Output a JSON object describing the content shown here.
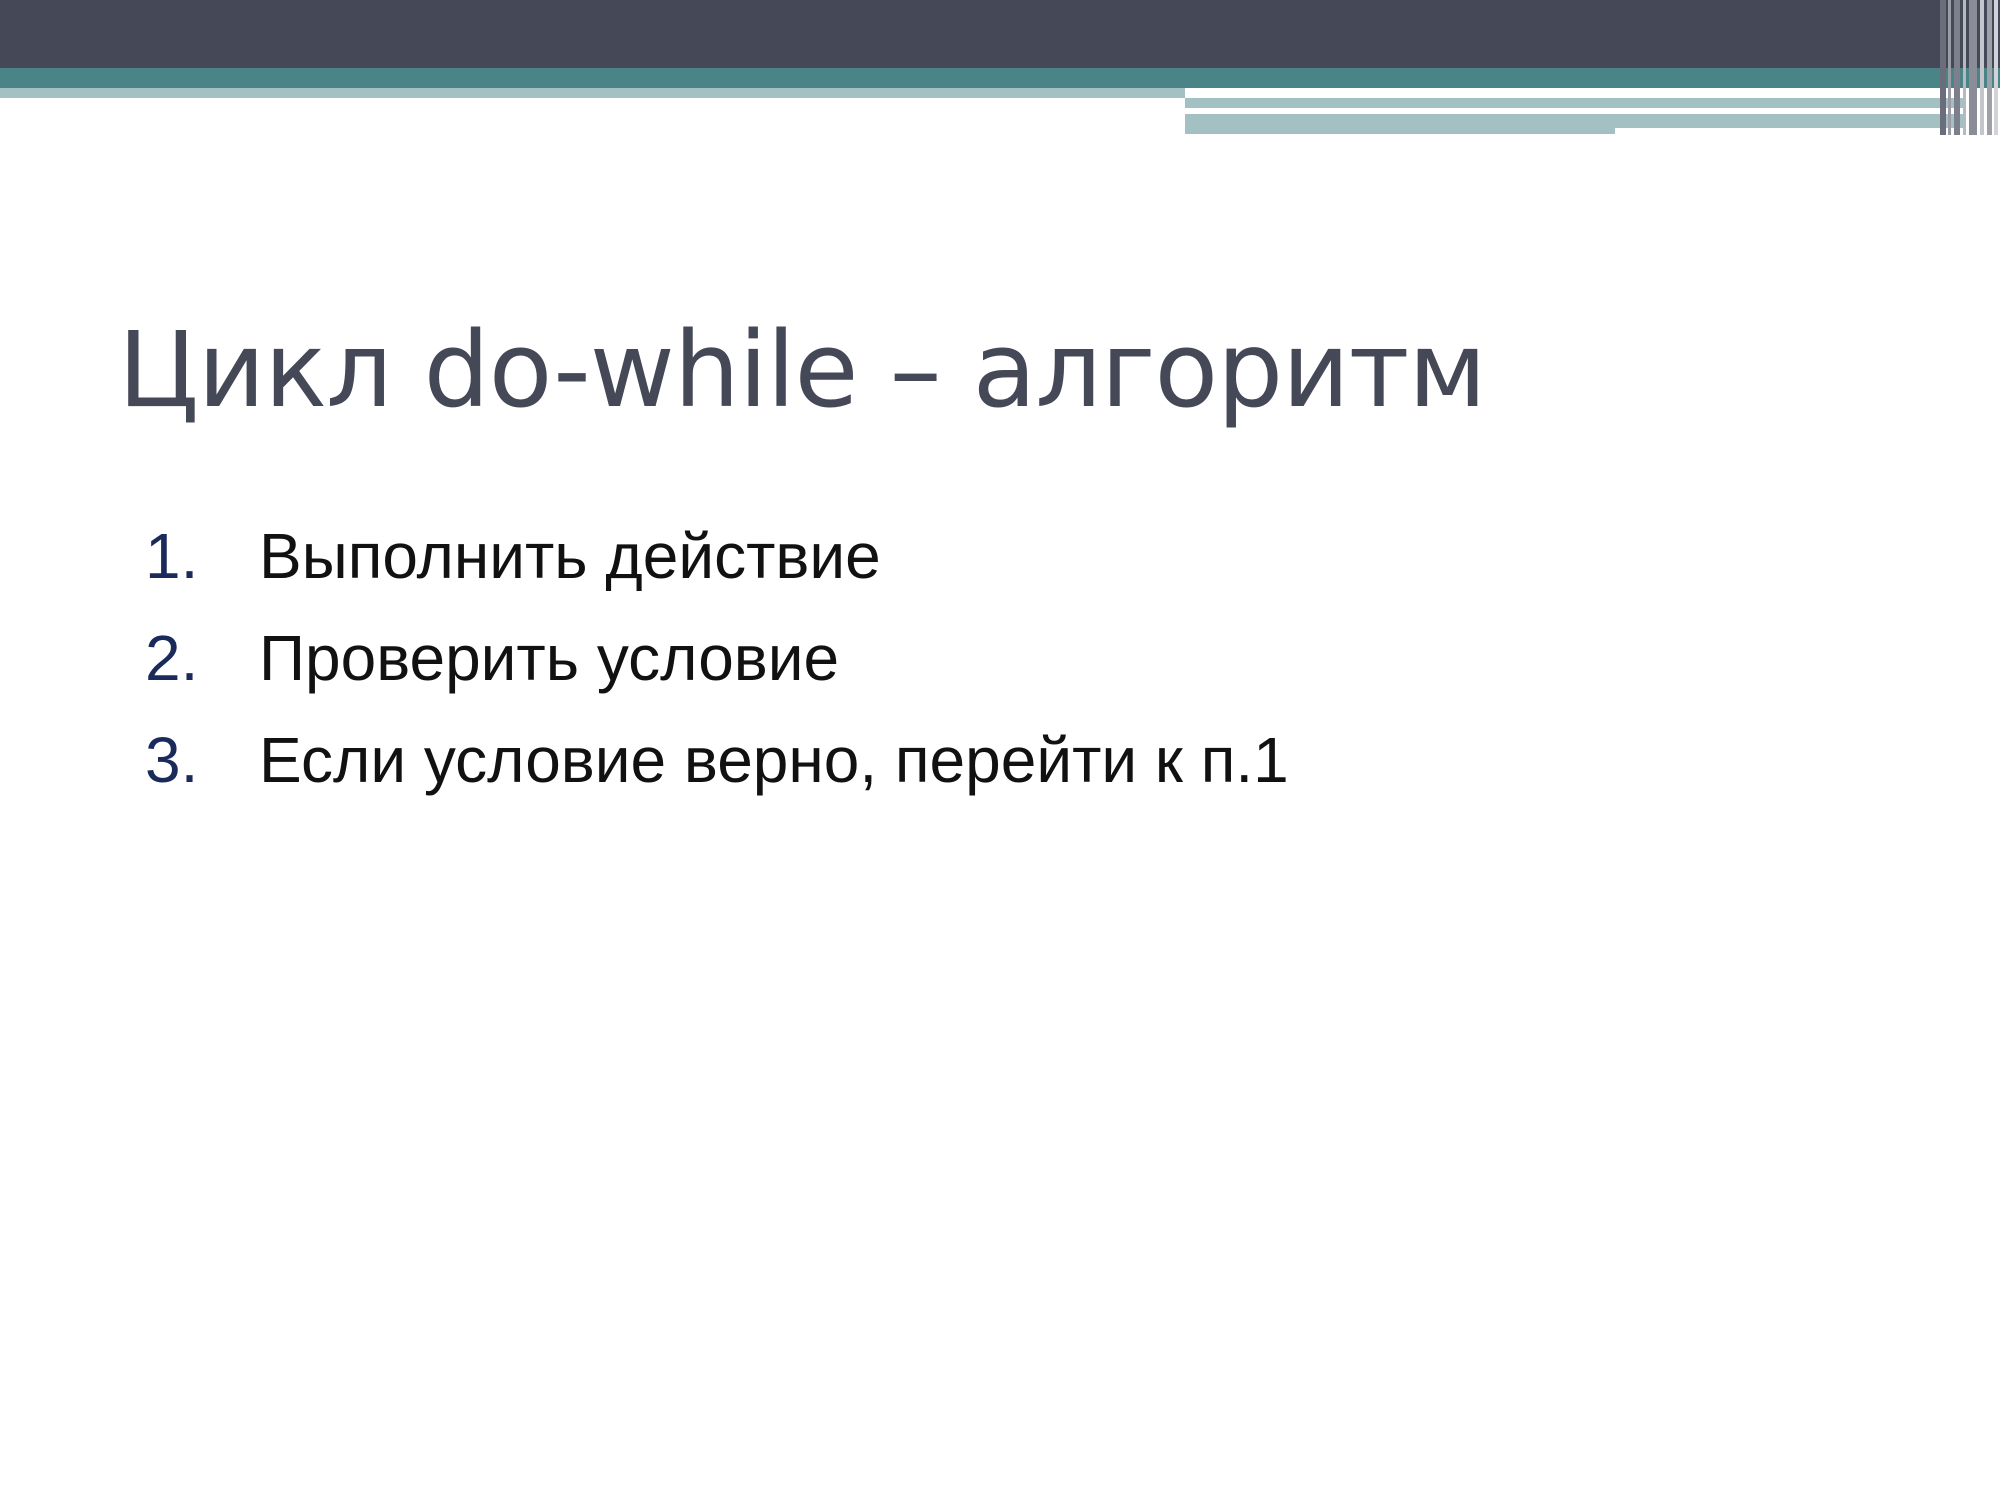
{
  "colors": {
    "header_dark": "#454856",
    "header_teal": "#4b8487",
    "header_light": "#a3c0c2",
    "title_text": "#454856",
    "list_number": "#1a2a5a",
    "list_text": "#111111"
  },
  "slide": {
    "title": "Цикл do-while – алгоритм",
    "items": [
      {
        "number": "1.",
        "text": "Выполнить действие"
      },
      {
        "number": "2.",
        "text": "Проверить условие"
      },
      {
        "number": "3.",
        "text": "Если условие верно, перейти к п.1"
      }
    ]
  }
}
